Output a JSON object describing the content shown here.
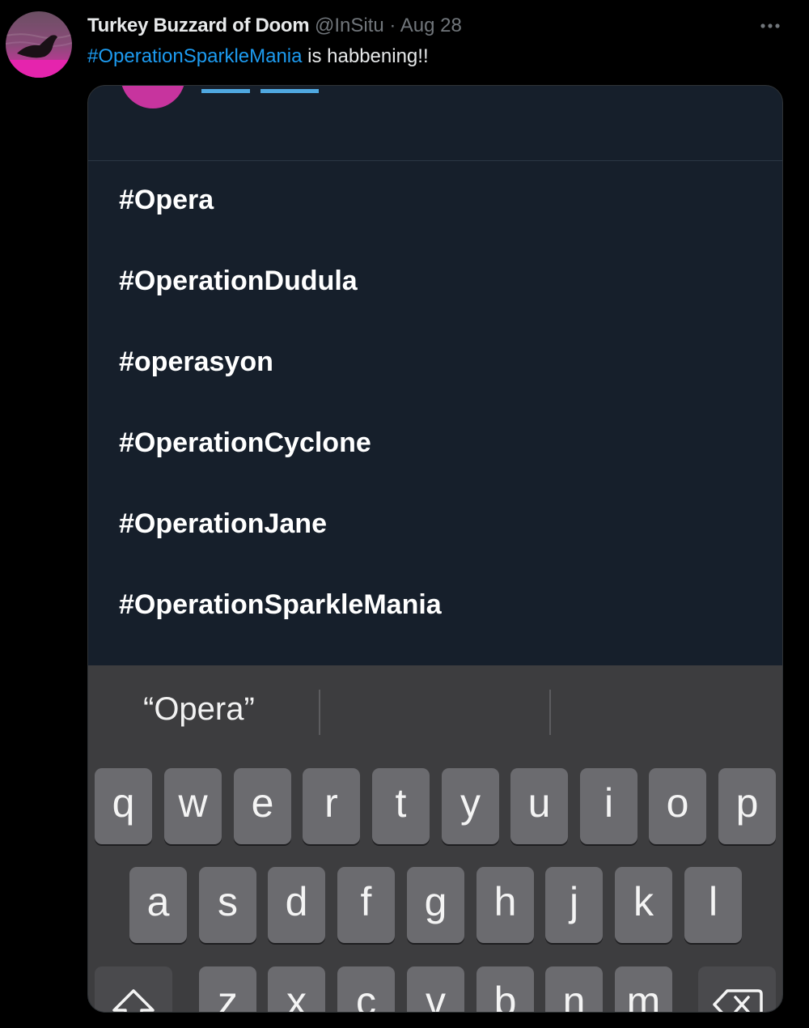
{
  "tweet": {
    "author": {
      "display_name": "Turkey Buzzard of Doom",
      "handle": "@InSitu",
      "separator": "·",
      "date": "Aug 28"
    },
    "more_icon": "more-dots-icon",
    "text": {
      "hashtag": "#OperationSparkleMania",
      "rest": " is habbening!!"
    },
    "colors": {
      "link": "#1d9bf0",
      "background": "#000000",
      "text": "#e7e9ea",
      "muted": "#71767b"
    }
  },
  "media": {
    "suggestions": [
      "#Opera",
      "#OperationDudula",
      "#operasyon",
      "#OperationCyclone",
      "#OperationJane",
      "#OperationSparkleMania"
    ],
    "keyboard": {
      "predictive": [
        "“Opera”",
        "",
        ""
      ],
      "rows": [
        [
          "q",
          "w",
          "e",
          "r",
          "t",
          "y",
          "u",
          "i",
          "o",
          "p"
        ],
        [
          "a",
          "s",
          "d",
          "f",
          "g",
          "h",
          "j",
          "k",
          "l"
        ],
        [
          "z",
          "x",
          "c",
          "v",
          "b",
          "n",
          "m"
        ]
      ],
      "shift_icon": "shift-arrow-icon",
      "backspace_icon": "backspace-icon"
    }
  }
}
